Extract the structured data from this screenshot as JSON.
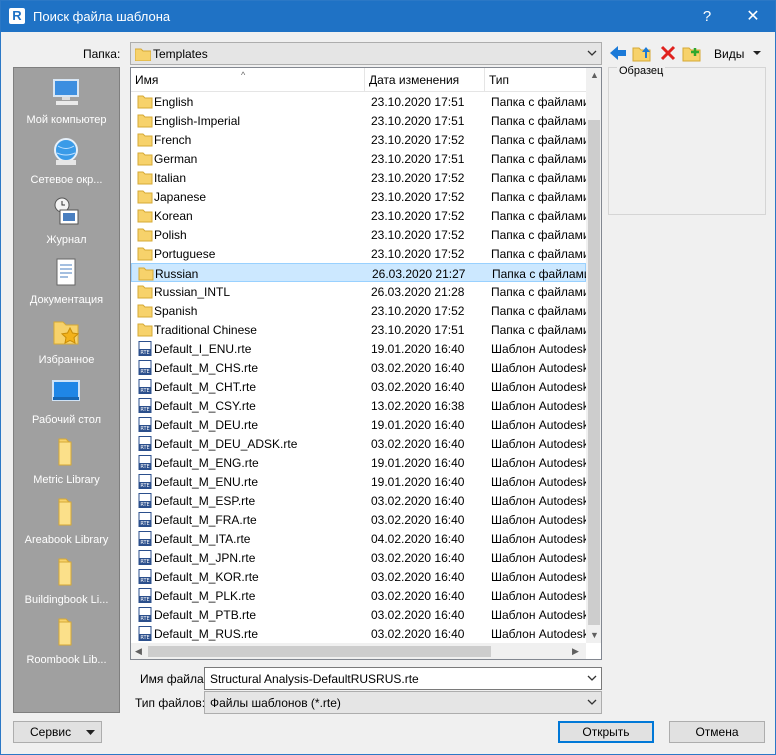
{
  "window": {
    "title": "Поиск файла шаблона",
    "help": "?",
    "close": "✕",
    "logo": "R"
  },
  "lookin": {
    "label": "Папка:",
    "value": "Templates"
  },
  "toolbar": {
    "views_label": "Виды"
  },
  "places": [
    {
      "label": "Мой компьютер",
      "icon": "computer-icon"
    },
    {
      "label": "Сетевое окр...",
      "icon": "network-icon"
    },
    {
      "label": "Журнал",
      "icon": "history-icon"
    },
    {
      "label": "Документация",
      "icon": "documents-icon"
    },
    {
      "label": "Избранное",
      "icon": "favorites-icon"
    },
    {
      "label": "Рабочий стол",
      "icon": "desktop-icon"
    },
    {
      "label": "Metric Library",
      "icon": "folder-icon"
    },
    {
      "label": "Areabook Library",
      "icon": "folder-icon"
    },
    {
      "label": "Buildingbook Li...",
      "icon": "folder-icon"
    },
    {
      "label": "Roombook Lib...",
      "icon": "folder-icon"
    }
  ],
  "columns": {
    "name": "Имя",
    "date": "Дата изменения",
    "type": "Тип"
  },
  "files": [
    {
      "name": "English",
      "date": "23.10.2020 17:51",
      "type": "Папка с файлами",
      "kind": "folder"
    },
    {
      "name": "English-Imperial",
      "date": "23.10.2020 17:51",
      "type": "Папка с файлами",
      "kind": "folder"
    },
    {
      "name": "French",
      "date": "23.10.2020 17:52",
      "type": "Папка с файлами",
      "kind": "folder"
    },
    {
      "name": "German",
      "date": "23.10.2020 17:51",
      "type": "Папка с файлами",
      "kind": "folder"
    },
    {
      "name": "Italian",
      "date": "23.10.2020 17:52",
      "type": "Папка с файлами",
      "kind": "folder"
    },
    {
      "name": "Japanese",
      "date": "23.10.2020 17:52",
      "type": "Папка с файлами",
      "kind": "folder"
    },
    {
      "name": "Korean",
      "date": "23.10.2020 17:52",
      "type": "Папка с файлами",
      "kind": "folder"
    },
    {
      "name": "Polish",
      "date": "23.10.2020 17:52",
      "type": "Папка с файлами",
      "kind": "folder"
    },
    {
      "name": "Portuguese",
      "date": "23.10.2020 17:52",
      "type": "Папка с файлами",
      "kind": "folder"
    },
    {
      "name": "Russian",
      "date": "26.03.2020 21:27",
      "type": "Папка с файлами",
      "kind": "folder",
      "selected": true
    },
    {
      "name": "Russian_INTL",
      "date": "26.03.2020 21:28",
      "type": "Папка с файлами",
      "kind": "folder"
    },
    {
      "name": "Spanish",
      "date": "23.10.2020 17:52",
      "type": "Папка с файлами",
      "kind": "folder"
    },
    {
      "name": "Traditional Chinese",
      "date": "23.10.2020 17:51",
      "type": "Папка с файлами",
      "kind": "folder"
    },
    {
      "name": "Default_I_ENU.rte",
      "date": "19.01.2020 16:40",
      "type": "Шаблон Autodesk",
      "kind": "rte"
    },
    {
      "name": "Default_M_CHS.rte",
      "date": "03.02.2020 16:40",
      "type": "Шаблон Autodesk",
      "kind": "rte"
    },
    {
      "name": "Default_M_CHT.rte",
      "date": "03.02.2020 16:40",
      "type": "Шаблон Autodesk",
      "kind": "rte"
    },
    {
      "name": "Default_M_CSY.rte",
      "date": "13.02.2020 16:38",
      "type": "Шаблон Autodesk",
      "kind": "rte"
    },
    {
      "name": "Default_M_DEU.rte",
      "date": "19.01.2020 16:40",
      "type": "Шаблон Autodesk",
      "kind": "rte"
    },
    {
      "name": "Default_M_DEU_ADSK.rte",
      "date": "03.02.2020 16:40",
      "type": "Шаблон Autodesk",
      "kind": "rte"
    },
    {
      "name": "Default_M_ENG.rte",
      "date": "19.01.2020 16:40",
      "type": "Шаблон Autodesk",
      "kind": "rte"
    },
    {
      "name": "Default_M_ENU.rte",
      "date": "19.01.2020 16:40",
      "type": "Шаблон Autodesk",
      "kind": "rte"
    },
    {
      "name": "Default_M_ESP.rte",
      "date": "03.02.2020 16:40",
      "type": "Шаблон Autodesk",
      "kind": "rte"
    },
    {
      "name": "Default_M_FRA.rte",
      "date": "03.02.2020 16:40",
      "type": "Шаблон Autodesk",
      "kind": "rte"
    },
    {
      "name": "Default_M_ITA.rte",
      "date": "04.02.2020 16:40",
      "type": "Шаблон Autodesk",
      "kind": "rte"
    },
    {
      "name": "Default_M_JPN.rte",
      "date": "03.02.2020 16:40",
      "type": "Шаблон Autodesk",
      "kind": "rte"
    },
    {
      "name": "Default_M_KOR.rte",
      "date": "03.02.2020 16:40",
      "type": "Шаблон Autodesk",
      "kind": "rte"
    },
    {
      "name": "Default_M_PLK.rte",
      "date": "03.02.2020 16:40",
      "type": "Шаблон Autodesk",
      "kind": "rte"
    },
    {
      "name": "Default_M_PTB.rte",
      "date": "03.02.2020 16:40",
      "type": "Шаблон Autodesk",
      "kind": "rte"
    },
    {
      "name": "Default_M_RUS.rte",
      "date": "03.02.2020 16:40",
      "type": "Шаблон Autodesk",
      "kind": "rte"
    }
  ],
  "preview": {
    "label": "Образец"
  },
  "filename": {
    "label": "Имя файла:",
    "value": "Structural Analysis-DefaultRUSRUS.rte"
  },
  "filetype": {
    "label": "Тип файлов:",
    "value": "Файлы шаблонов  (*.rte)"
  },
  "buttons": {
    "service": "Сервис",
    "open": "Открыть",
    "cancel": "Отмена"
  },
  "colors": {
    "titlebar": "#1f72c5",
    "places_bg": "#a0a0a0",
    "selection": "#cce8ff",
    "folder": "#f7d26b"
  }
}
